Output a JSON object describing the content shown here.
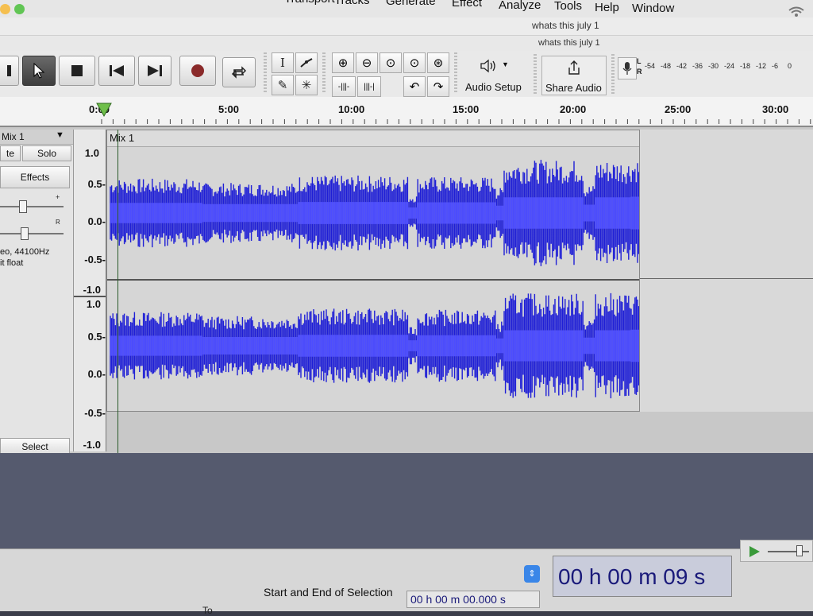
{
  "menubar": {
    "items": [
      "Transport",
      "Tracks",
      "Generate",
      "Effect",
      "Analyze",
      "Tools",
      "Help",
      "Window"
    ]
  },
  "window": {
    "title": "whats this july 1",
    "subtitle": "whats this july 1"
  },
  "toolbar": {
    "audio_setup_label": "Audio Setup",
    "share_audio_label": "Share Audio",
    "meter_channels": [
      "L",
      "R"
    ],
    "meter_ticks": [
      "-54",
      "-48",
      "-42",
      "-36",
      "-30",
      "-24",
      "-18",
      "-12",
      "-6",
      "0"
    ]
  },
  "ruler": {
    "labels": [
      "0:00",
      "5:00",
      "10:00",
      "15:00",
      "20:00",
      "25:00",
      "30:00"
    ]
  },
  "track": {
    "name": "Mix 1",
    "clip_name": "Mix 1",
    "mute_label": "te",
    "solo_label": "Solo",
    "effects_label": "Effects",
    "gain_plus": "+",
    "pan_right": "R",
    "info_line1": "eo, 44100Hz",
    "info_line2": "it float",
    "select_label": "Select",
    "scale_top": [
      "1.0",
      "0.5-",
      "0.0-",
      "-0.5-",
      "-1.0"
    ],
    "scale_bottom": [
      "1.0",
      "0.5-",
      "0.0-",
      "-0.5-",
      "-1.0"
    ]
  },
  "selection": {
    "label": "Start and End of Selection",
    "start_time": "00 h 00 m 00.000 s",
    "time_display": "00 h 00 m 09 s",
    "to_label": "To"
  },
  "colors": {
    "waveform": "#1f1fd6",
    "waveform_rms": "#4d4dff",
    "clip_bg": "#d6d6d6",
    "time_text": "#1a1a7a"
  },
  "icons": {
    "pause": "pause-icon",
    "select_tool": "cursor-icon",
    "stop": "stop-icon",
    "skip_start": "skip-start-icon",
    "skip_end": "skip-end-icon",
    "record": "record-icon",
    "loop": "loop-icon",
    "speaker": "speaker-icon",
    "share": "share-icon",
    "microphone": "microphone-icon"
  }
}
